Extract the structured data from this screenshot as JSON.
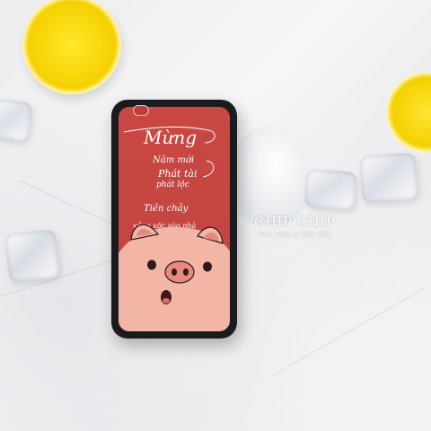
{
  "photo": {
    "subject": "phone case",
    "case_text": {
      "line1": "Mừng",
      "line2": "Năm mới",
      "line3": "Phát tài",
      "line4": "phát lộc",
      "line5": "Tiền chảy",
      "line6": "xồng xộc vào nhà"
    },
    "watermark": {
      "name": "CHIP CHIP",
      "tagline": "Gấu_bông_&_phụ_kiện"
    },
    "colors": {
      "case": "#c64643",
      "pig": "#f2b5a6",
      "lemon": "#f4d000"
    }
  }
}
